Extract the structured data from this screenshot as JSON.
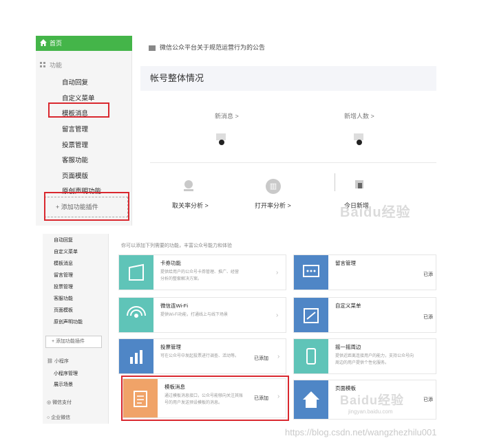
{
  "top": {
    "sidebar": {
      "home": "首页",
      "group": "功能",
      "items": [
        "自动回复",
        "自定义菜单",
        "模板消息",
        "留言管理",
        "投票管理",
        "客服功能",
        "页面模版",
        "原创声明功能"
      ],
      "add_plugin": "+ 添加功能插件"
    },
    "notice": "微信公众平台关于规范运营行为的公告",
    "account_title": "帐号整体情况",
    "stats": {
      "new_messages": "新消息 >",
      "new_followers": "新增人数 >"
    },
    "analysis": {
      "unfollow": "取关率分析 >",
      "open": "打开率分析 >",
      "today": "今日新增"
    },
    "watermark": "Baidu经验"
  },
  "bottom": {
    "sidebar": {
      "items": [
        "自动回复",
        "自定义菜单",
        "模板消息",
        "留言管理",
        "投票管理",
        "客服功能",
        "页面模板",
        "原创声明功能"
      ],
      "add_plugin": "+ 添加功能插件",
      "mini_program": "小程序",
      "mini_items": [
        "小程序管理",
        "展示场景"
      ],
      "wechat_pay": "微信支付",
      "enterprise": "企业微信"
    },
    "tip": "你可以添加下列需要的功能，丰富公众号能力和体验",
    "cards": [
      {
        "title": "卡券功能",
        "desc": "提供给用户的公众号卡券管理、推广、经营分析的整套解决方案。",
        "status": "",
        "color": "#5fc4b8"
      },
      {
        "title": "留言管理",
        "desc": "",
        "status": "已添",
        "color": "#4f86c6"
      },
      {
        "title": "微信连Wi-Fi",
        "desc": "提供Wi-Fi功能，打通线上与线下场景",
        "status": "",
        "color": "#5fc4b8"
      },
      {
        "title": "自定义菜单",
        "desc": "",
        "status": "已添",
        "color": "#4f86c6"
      },
      {
        "title": "投票管理",
        "desc": "可在公众号中发起投票进行调查、活动等。",
        "status": "已添加",
        "color": "#4f86c6"
      },
      {
        "title": "摇一摇周边",
        "desc": "提供近距离连接用户的能力，支持公众号向周边的用户提供个性化服务。",
        "status": "",
        "color": "#5fc4b8"
      },
      {
        "title": "模板消息",
        "desc": "通过模板消息接口，公众号能够向关注其账号的用户发送预设模板的消息。",
        "status": "已添加",
        "color": "#f0a368"
      },
      {
        "title": "页面模板",
        "desc": "",
        "status": "已添",
        "color": "#4f86c6"
      }
    ],
    "watermark": "Baidu经验",
    "watermark_url": "jingyan.baidu.com"
  },
  "footer_url": "https://blog.csdn.net/wangzhezhilu001"
}
